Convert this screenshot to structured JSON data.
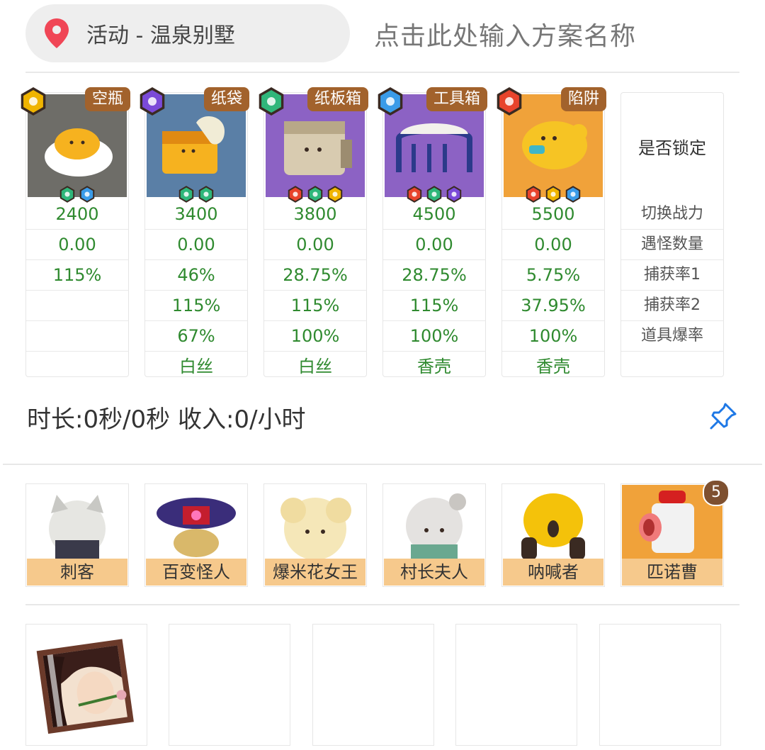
{
  "header": {
    "location": "活动 - 温泉别墅",
    "plan_name_placeholder": "点击此处输入方案名称"
  },
  "traps": [
    {
      "name": "空瓶",
      "power": "2400",
      "enc": "0.00",
      "cap1": "115%",
      "cap2": "",
      "drop": "",
      "item": "",
      "gem": "gold",
      "bg": "#6e6d68",
      "elements": [
        "green",
        "blue"
      ]
    },
    {
      "name": "纸袋",
      "power": "3400",
      "enc": "0.00",
      "cap1": "46%",
      "cap2": "115%",
      "drop": "67%",
      "item": "白丝",
      "gem": "purple",
      "bg": "#5a7fa6",
      "elements": [
        "green",
        "green"
      ]
    },
    {
      "name": "纸板箱",
      "power": "3800",
      "enc": "0.00",
      "cap1": "28.75%",
      "cap2": "115%",
      "drop": "100%",
      "item": "白丝",
      "gem": "green",
      "bg": "#8c62c4",
      "elements": [
        "red",
        "green",
        "gold"
      ]
    },
    {
      "name": "工具箱",
      "power": "4500",
      "enc": "0.00",
      "cap1": "28.75%",
      "cap2": "115%",
      "drop": "100%",
      "item": "香壳",
      "gem": "blue",
      "bg": "#8c62c4",
      "elements": [
        "red",
        "green",
        "purple"
      ]
    },
    {
      "name": "陷阱",
      "power": "5500",
      "enc": "0.00",
      "cap1": "5.75%",
      "cap2": "37.95%",
      "drop": "100%",
      "item": "香壳",
      "gem": "red",
      "bg": "#f0a23a",
      "elements": [
        "red",
        "gold",
        "blue"
      ]
    }
  ],
  "labels": {
    "lock": "是否锁定",
    "rows": [
      "切换战力",
      "遇怪数量",
      "捕获率1",
      "捕获率2",
      "道具爆率"
    ]
  },
  "stats": "时长:0秒/0秒 收入:0/小时",
  "monsters": [
    "刺客",
    "百变怪人",
    "爆米花女王",
    "村长夫人",
    "呐喊者",
    "匹诺曹"
  ],
  "monster_badge": "5",
  "colors": {
    "value_green": "#2f8a2f",
    "tag_brown": "#a2622c",
    "name_strip": "#f6c98c",
    "pin_red": "#f04656",
    "pin_blue": "#1e78e6"
  }
}
